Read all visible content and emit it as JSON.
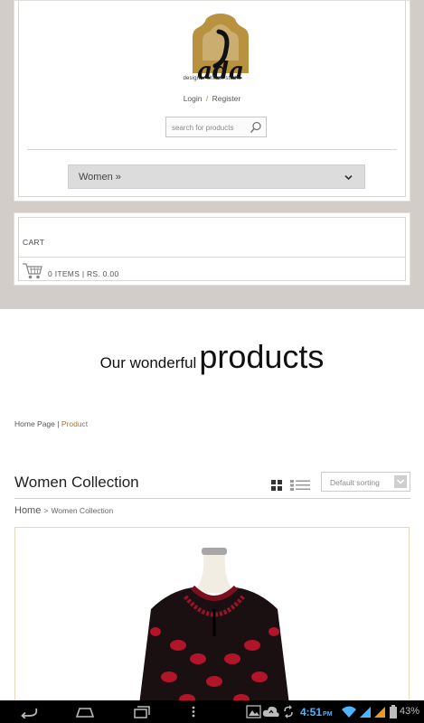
{
  "header": {
    "logo_text": "ada",
    "logo_caption": "designer chikan studio",
    "login_label": "Login",
    "auth_separator": "/",
    "register_label": "Register",
    "search_placeholder": "search for products",
    "menu_label": "Women »"
  },
  "cart": {
    "title": "CART",
    "summary": "0 ITEMS | RS. 0.00"
  },
  "hero": {
    "small": "Our wonderful",
    "big": "products"
  },
  "breadcrumb_top": {
    "home": "Home Page",
    "separator": "|",
    "current": "Product"
  },
  "collection": {
    "title": "Women Collection",
    "sort_label": "Default sorting",
    "view_modes": [
      "grid-icon",
      "list-icon"
    ]
  },
  "breadcrumb_collection": {
    "home": "Home",
    "separator": ">",
    "current": "Women Collection"
  },
  "statusbar": {
    "time": "4:51",
    "ampm": "PM",
    "battery": "43%"
  },
  "colors": {
    "band": "#d2cdc8",
    "accent_gold": "#9a7836",
    "clock_blue": "#4fb4ff"
  }
}
